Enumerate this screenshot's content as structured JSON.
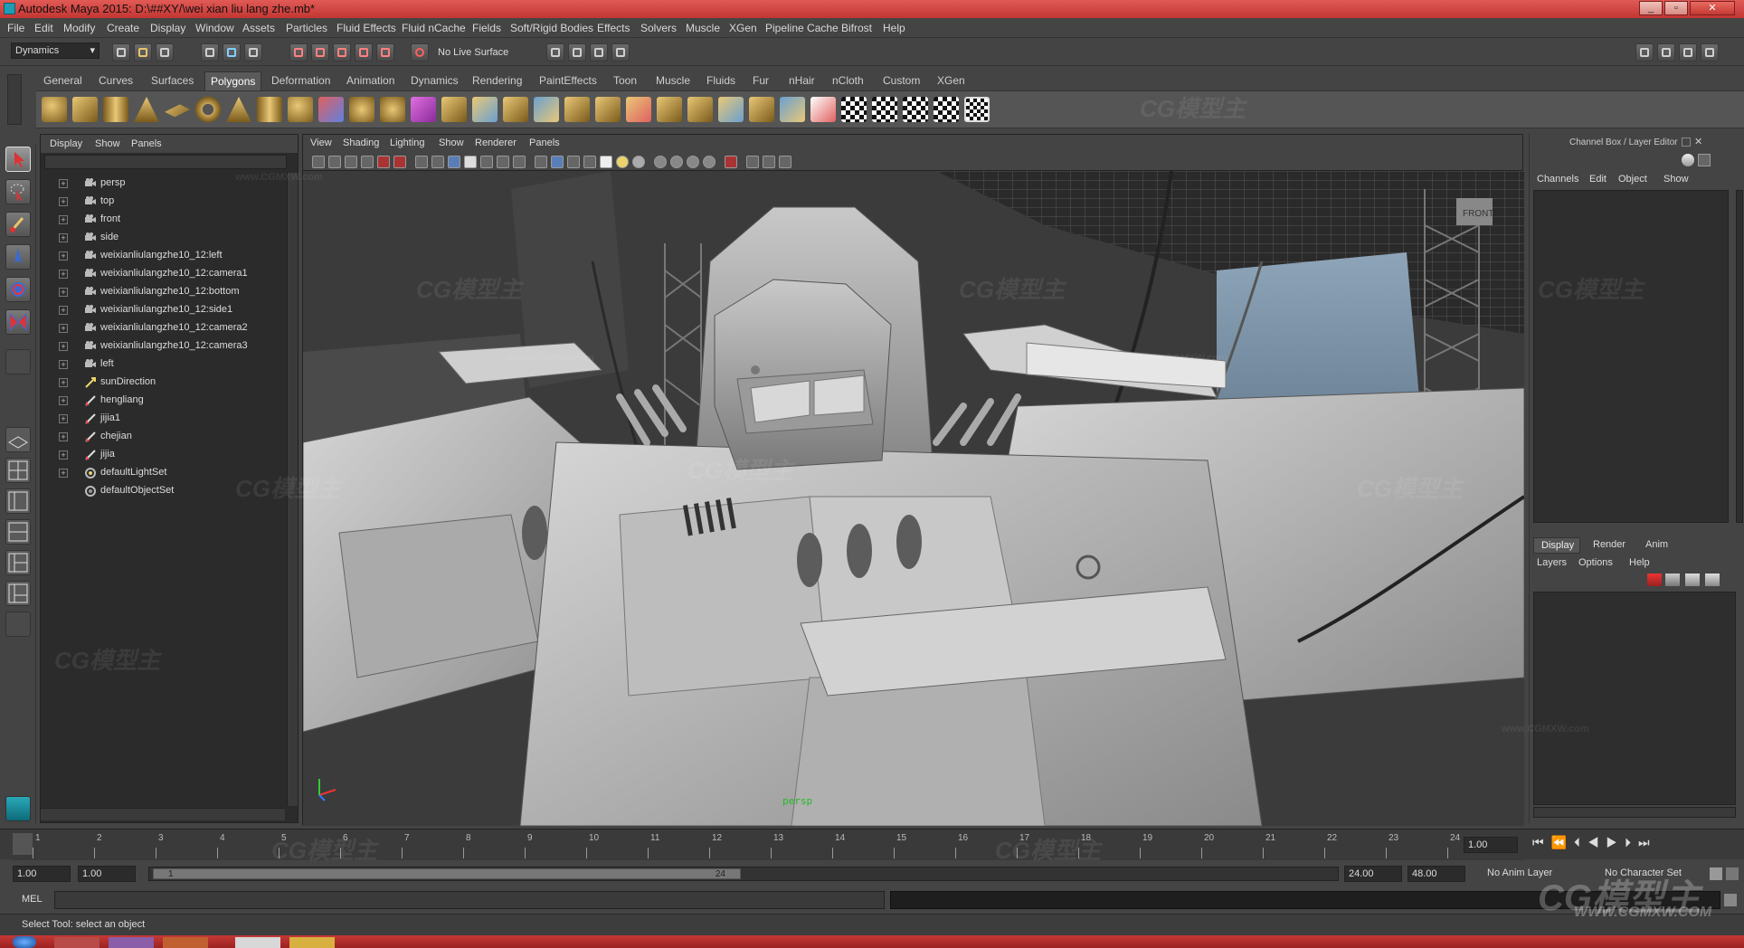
{
  "window": {
    "title": "Autodesk Maya 2015: D:\\##XY/\\wei xian liu lang zhe.mb*",
    "controls": [
      "_",
      "▫",
      "✕"
    ]
  },
  "menus": [
    "File",
    "Edit",
    "Modify",
    "Create",
    "Display",
    "Window",
    "Assets",
    "Particles",
    "Fluid Effects",
    "Fluid nCache",
    "Fields",
    "Soft/Rigid Bodies",
    "Effects",
    "Solvers",
    "Muscle",
    "XGen",
    "Pipeline Cache",
    "Bifrost",
    "Help"
  ],
  "statusline": {
    "menuset": "Dynamics",
    "live_surface": "No Live Surface"
  },
  "shelf_tabs": [
    "General",
    "Curves",
    "Surfaces",
    "Polygons",
    "Deformation",
    "Animation",
    "Dynamics",
    "Rendering",
    "PaintEffects",
    "Toon",
    "Muscle",
    "Fluids",
    "Fur",
    "nHair",
    "nCloth",
    "Custom",
    "XGen"
  ],
  "active_shelf_tab": "Polygons",
  "outliner": {
    "menu": [
      "Display",
      "Show",
      "Panels"
    ],
    "items": [
      {
        "label": "persp",
        "icon": "camera-icon"
      },
      {
        "label": "top",
        "icon": "camera-icon"
      },
      {
        "label": "front",
        "icon": "camera-icon"
      },
      {
        "label": "side",
        "icon": "camera-icon"
      },
      {
        "label": "weixianliulangzhe10_12:left",
        "icon": "camera-icon"
      },
      {
        "label": "weixianliulangzhe10_12:camera1",
        "icon": "camera-icon"
      },
      {
        "label": "weixianliulangzhe10_12:bottom",
        "icon": "camera-icon"
      },
      {
        "label": "weixianliulangzhe10_12:side1",
        "icon": "camera-icon"
      },
      {
        "label": "weixianliulangzhe10_12:camera2",
        "icon": "camera-icon"
      },
      {
        "label": "weixianliulangzhe10_12:camera3",
        "icon": "camera-icon"
      },
      {
        "label": "left",
        "icon": "camera-icon"
      },
      {
        "label": "sunDirection",
        "icon": "light-icon"
      },
      {
        "label": "hengliang",
        "icon": "transform-icon"
      },
      {
        "label": "jijia1",
        "icon": "transform-icon"
      },
      {
        "label": "chejian",
        "icon": "transform-icon"
      },
      {
        "label": "jijia",
        "icon": "transform-icon"
      },
      {
        "label": "defaultLightSet",
        "icon": "set-icon"
      },
      {
        "label": "defaultObjectSet",
        "icon": "set-icon"
      }
    ]
  },
  "viewport": {
    "menu": [
      "View",
      "Shading",
      "Lighting",
      "Show",
      "Renderer",
      "Panels"
    ],
    "camera_label": "persp",
    "cube_label": "FRONT"
  },
  "channel_box": {
    "title": "Channel Box / Layer Editor",
    "menu": [
      "Channels",
      "Edit",
      "Object",
      "Show"
    ],
    "layer_tabs": [
      "Display",
      "Render",
      "Anim"
    ],
    "layer_menu": [
      "Layers",
      "Options",
      "Help"
    ]
  },
  "timeline": {
    "ticks": [
      "1",
      "2",
      "3",
      "4",
      "5",
      "6",
      "7",
      "8",
      "9",
      "10",
      "11",
      "12",
      "13",
      "14",
      "15",
      "16",
      "17",
      "18",
      "19",
      "20",
      "21",
      "22",
      "23",
      "24"
    ],
    "current_frame": "1.00",
    "start": "1.00",
    "start2": "1.00",
    "range_start": "1",
    "range_end": "24",
    "end": "24.00",
    "end2": "48.00",
    "anim_layer": "No Anim Layer",
    "character_set": "No Character Set"
  },
  "command_line": {
    "label": "MEL"
  },
  "help_line": "Select Tool: select an object",
  "watermark": {
    "text": "CG模型主",
    "url": "www.CGMXW.com",
    "url2": "WWW.CGMXW.COM"
  }
}
